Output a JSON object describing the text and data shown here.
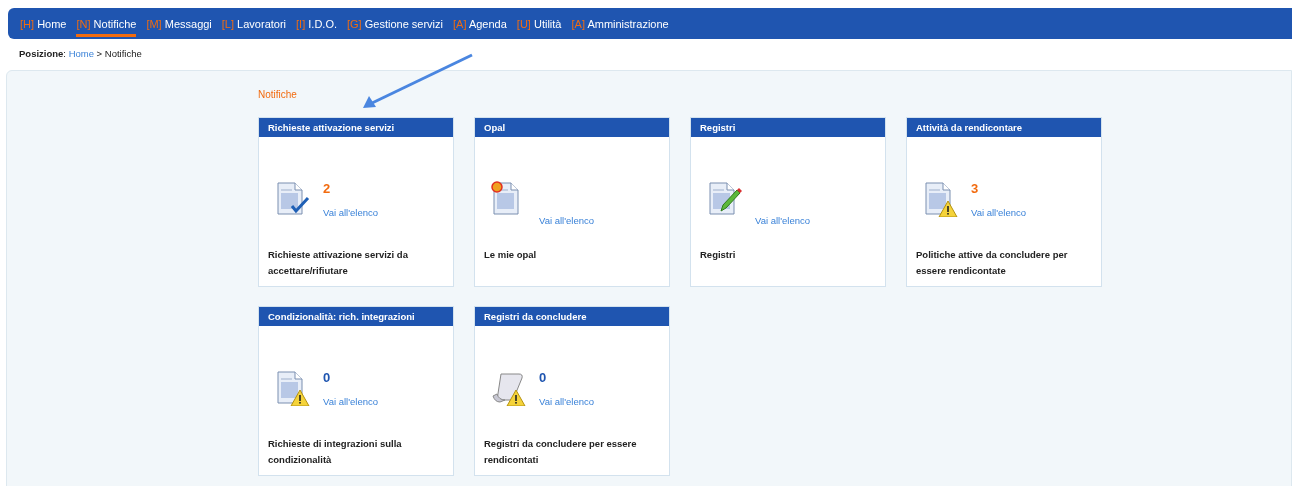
{
  "nav": {
    "items": [
      {
        "key": "[H]",
        "label": "Home",
        "selected": false
      },
      {
        "key": "[N]",
        "label": "Notifiche",
        "selected": true
      },
      {
        "key": "[M]",
        "label": "Messaggi",
        "selected": false
      },
      {
        "key": "[L]",
        "label": "Lavoratori",
        "selected": false
      },
      {
        "key": "[I]",
        "label": "I.D.O.",
        "selected": false
      },
      {
        "key": "[G]",
        "label": "Gestione servizi",
        "selected": false
      },
      {
        "key": "[A]",
        "label": "Agenda",
        "selected": false
      },
      {
        "key": "[U]",
        "label": "Utilità",
        "selected": false
      },
      {
        "key": "[A]",
        "label": "Amministrazione",
        "selected": false
      }
    ]
  },
  "breadcrumb": {
    "label": "**Posizione**:",
    "home": "Home",
    "separator": ">",
    "current": "Notifiche"
  },
  "section_title": "Notifiche",
  "cards": [
    {
      "title": "Richieste attivazione servizi",
      "kind": "check-doc",
      "count": "2",
      "alert": true,
      "link": "Vai all'elenco",
      "description": "Richieste attivazione servizi da accettare/rifiutare"
    },
    {
      "title": "Opal",
      "kind": "new-doc",
      "link": "Vai all'elenco",
      "description": "Le mie opal"
    },
    {
      "title": "Registri",
      "kind": "edit-doc",
      "link": "Vai all'elenco",
      "description": "Registri"
    },
    {
      "title": "Attività da rendicontare",
      "kind": "warning-doc",
      "count": "3",
      "alert": true,
      "link": "Vai all'elenco",
      "description": "Politiche attive da concludere per essere rendicontate"
    },
    {
      "title": "Condizionalità: rich. integrazioni",
      "kind": "warning-doc",
      "count": "0",
      "alert": false,
      "link": "Vai all'elenco",
      "description": "Richieste di integrazioni sulla condizionalità"
    },
    {
      "title": "Registri da concludere",
      "kind": "warning-scroll",
      "count": "0",
      "alert": false,
      "link": "Vai all'elenco",
      "description": "Registri da concludere per essere rendicontati"
    }
  ]
}
